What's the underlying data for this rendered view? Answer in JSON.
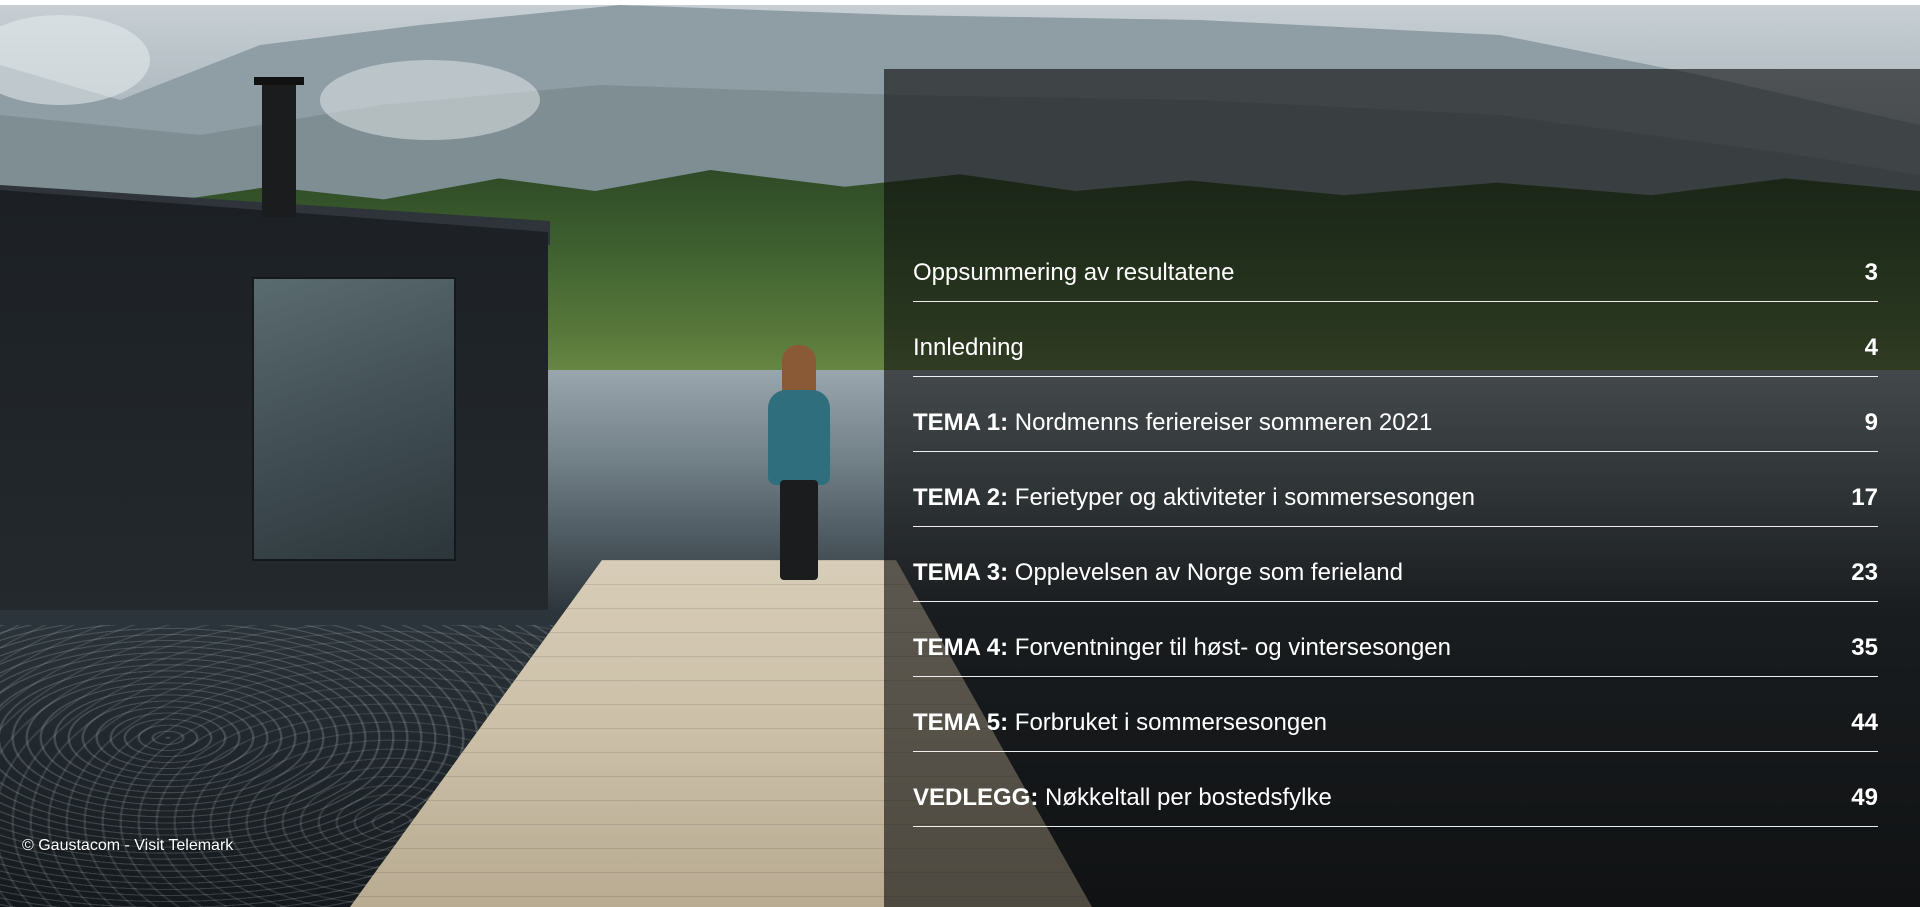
{
  "toc": {
    "items": [
      {
        "label": "",
        "title": "Oppsummering av resultatene",
        "page": "3"
      },
      {
        "label": "",
        "title": "Innledning",
        "page": "4"
      },
      {
        "label": "TEMA 1:",
        "title": "Nordmenns feriereiser sommeren 2021",
        "page": "9"
      },
      {
        "label": "TEMA 2:",
        "title": "Ferietyper og aktiviteter i sommersesongen",
        "page": "17"
      },
      {
        "label": "TEMA 3:",
        "title": "Opplevelsen av Norge som ferieland",
        "page": "23"
      },
      {
        "label": "TEMA 4:",
        "title": "Forventninger til høst- og vintersesongen",
        "page": "35"
      },
      {
        "label": "TEMA 5:",
        "title": "Forbruket i sommersesongen",
        "page": "44"
      },
      {
        "label": "VEDLEGG:",
        "title": "Nøkkeltall per bostedsfylke",
        "page": "49"
      }
    ]
  },
  "credit": "© Gaustacom - Visit Telemark",
  "colors": {
    "text": "#ffffff",
    "panel": "rgba(15,15,15,0.62)"
  }
}
